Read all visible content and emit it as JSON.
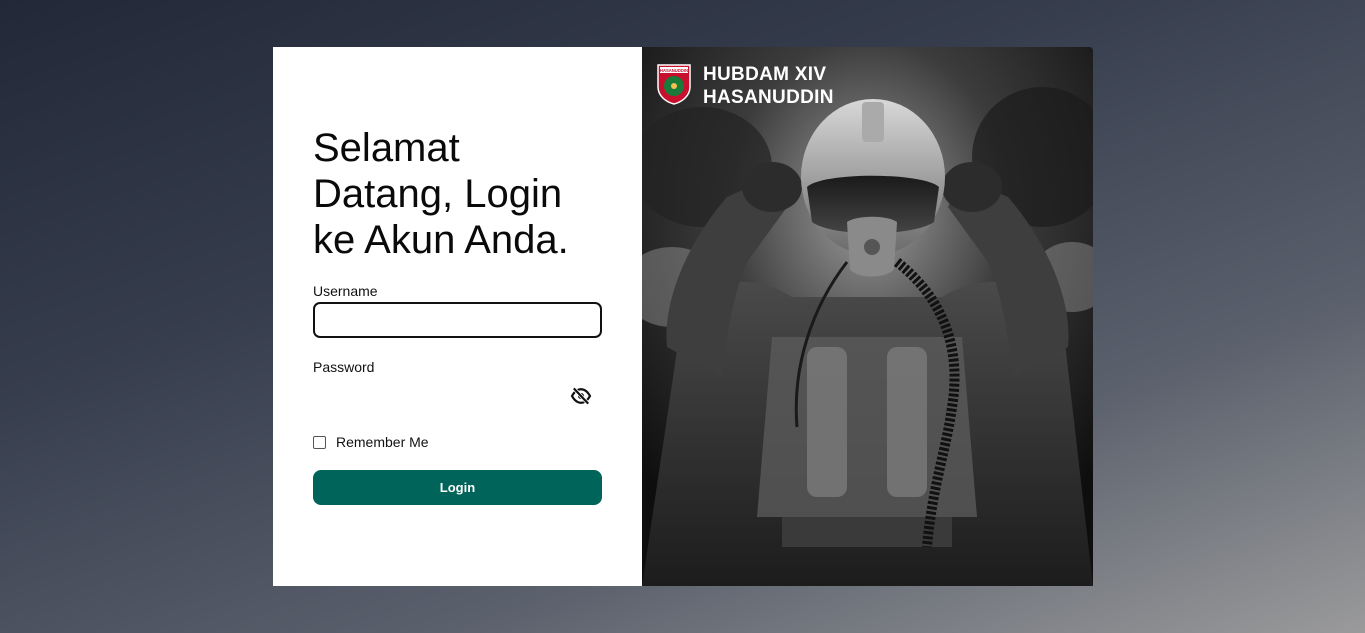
{
  "login": {
    "heading": "Selamat Datang, Login ke Akun Anda.",
    "username_label": "Username",
    "username_value": "",
    "password_label": "Password",
    "password_value": "",
    "remember_label": "Remember Me",
    "remember_checked": false,
    "submit_label": "Login"
  },
  "brand": {
    "line1": "HUBDAM XIV",
    "line2": "HASANUDDIN",
    "emblem_text": "HASANUDDIN"
  },
  "icons": {
    "password_toggle": "eye-slash-icon",
    "emblem": "shield-emblem-icon"
  },
  "colors": {
    "primary": "#00645a",
    "emblem_red": "#c8102e",
    "emblem_green": "#1a7a3a"
  }
}
